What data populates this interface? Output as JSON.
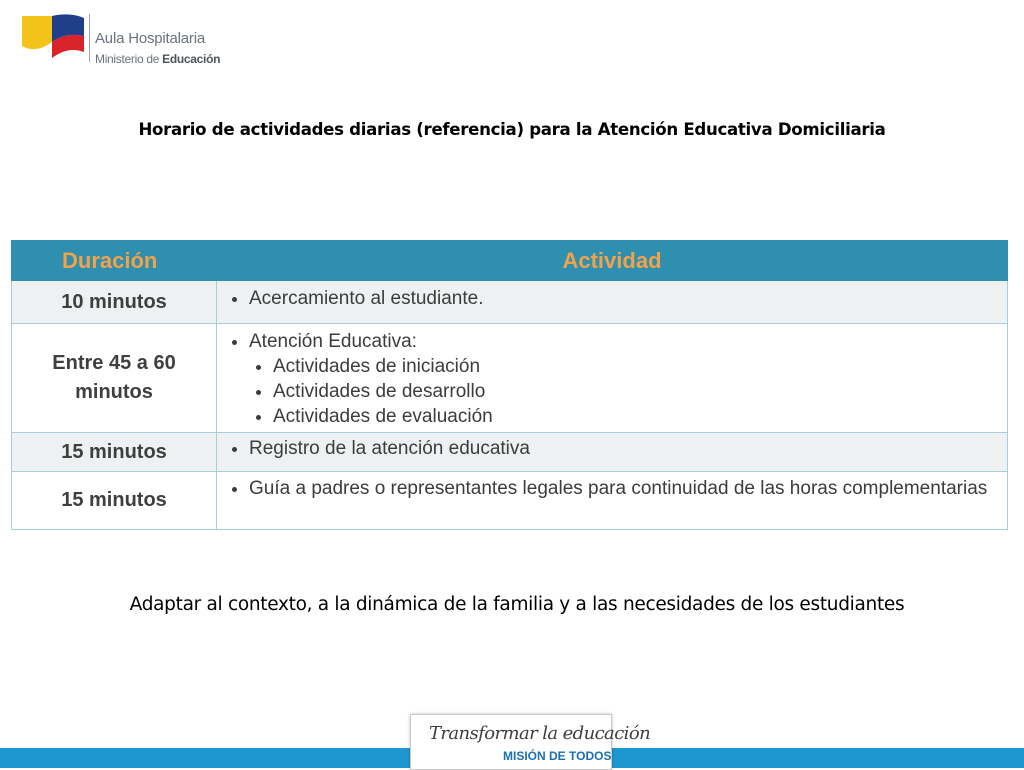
{
  "logo": {
    "line1": "Aula Hospitalaria",
    "line2_prefix": "Ministerio de ",
    "line2_bold": "Educación",
    "colors": {
      "yellow": "#f2c318",
      "blue": "#1f3f8a",
      "red": "#d8232a"
    }
  },
  "title": "Horario de actividades diarias (referencia) para la Atención Educativa Domiciliaria",
  "table": {
    "headers": {
      "duration": "Duración",
      "activity": "Actividad"
    },
    "rows": [
      {
        "duration": "10 minutos",
        "item": "Acercamiento al estudiante."
      },
      {
        "duration": "Entre 45 a 60 minutos",
        "item": "Atención Educativa:",
        "subitems": [
          "Actividades de iniciación",
          "Actividades de desarrollo",
          "Actividades de evaluación"
        ]
      },
      {
        "duration": "15 minutos",
        "item": "Registro de la atención educativa"
      },
      {
        "duration": "15 minutos",
        "item": "Guía a padres o representantes legales para continuidad de las horas complementarias"
      }
    ],
    "colors": {
      "header_bg": "#2e8fae",
      "header_text": "#f2a24a",
      "border": "#a7cedd",
      "alt_row": "#eef1f2"
    }
  },
  "note": "Adaptar al contexto, a la dinámica de la familia y a las necesidades de los estudiantes",
  "footer": {
    "slogan_top": "Transformar la educación",
    "slogan_bottom": "MISIÓN DE TODOS",
    "band_color": "#1e96cf"
  }
}
